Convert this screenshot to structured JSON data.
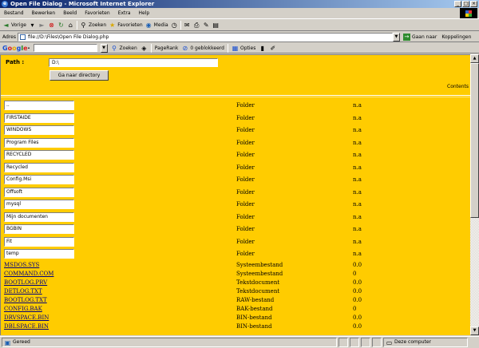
{
  "window": {
    "title": "Open File Dialog - Microsoft Internet Explorer"
  },
  "menu": [
    "Bestand",
    "Bewerken",
    "Beeld",
    "Favorieten",
    "Extra",
    "Help"
  ],
  "toolbar": {
    "back": "Vorige",
    "search": "Zoeken",
    "favorites": "Favorieten",
    "media": "Media"
  },
  "address": {
    "label": "Adres",
    "url": "file://D:\\Files\\Open File Dialog.php",
    "go": "Gaan naar",
    "links": "Koppelingen"
  },
  "googlebar": {
    "logo": "Google",
    "search_btn": "Zoeken",
    "pagerank": "PageRank",
    "blocked": "0 geblokkeerd",
    "options": "Opties"
  },
  "form": {
    "path_label": "Path :",
    "path_value": "D:\\",
    "goto_button": "Ga naar directory",
    "contents_label": "Contents"
  },
  "folders": [
    {
      "name": "..",
      "type": "Folder",
      "size": "n.a"
    },
    {
      "name": "FIRSTAIDE",
      "type": "Folder",
      "size": "n.a"
    },
    {
      "name": "WINDOWS",
      "type": "Folder",
      "size": "n.a"
    },
    {
      "name": "Program Files",
      "type": "Folder",
      "size": "n.a"
    },
    {
      "name": "RECYCLED",
      "type": "Folder",
      "size": "n.a"
    },
    {
      "name": "Recycled",
      "type": "Folder",
      "size": "n.a"
    },
    {
      "name": "Config.Msi",
      "type": "Folder",
      "size": "n.a"
    },
    {
      "name": "Offsoft",
      "type": "Folder",
      "size": "n.a"
    },
    {
      "name": "mysql",
      "type": "Folder",
      "size": "n.a"
    },
    {
      "name": "Mijn documenten",
      "type": "Folder",
      "size": "n.a"
    },
    {
      "name": "BGBIN",
      "type": "Folder",
      "size": "n.a"
    },
    {
      "name": "Fit",
      "type": "Folder",
      "size": "n.a"
    },
    {
      "name": "temp",
      "type": "Folder",
      "size": "n.a"
    }
  ],
  "files": [
    {
      "name": "MSDOS.SYS",
      "type": "Systeembestand",
      "size": "0.0"
    },
    {
      "name": "COMMAND.COM",
      "type": "Systeembestand",
      "size": "0"
    },
    {
      "name": "BOOTLOG.PRV",
      "type": "Tekstdocument",
      "size": "0.0"
    },
    {
      "name": "DETLOG.TXT",
      "type": "Tekstdocument",
      "size": "0.0"
    },
    {
      "name": "BOOTLOG.TXT",
      "type": "RAW-bestand",
      "size": "0.0"
    },
    {
      "name": "CONFIG.BAK",
      "type": "BAK-bestand",
      "size": "0"
    },
    {
      "name": "DRVSPACE.BIN",
      "type": "BIN-bestand",
      "size": "0.0"
    },
    {
      "name": "DBLSPACE.BIN",
      "type": "BIN-bestand",
      "size": "0.0"
    }
  ],
  "status": {
    "text": "Gereed",
    "zone": "Deze computer"
  }
}
